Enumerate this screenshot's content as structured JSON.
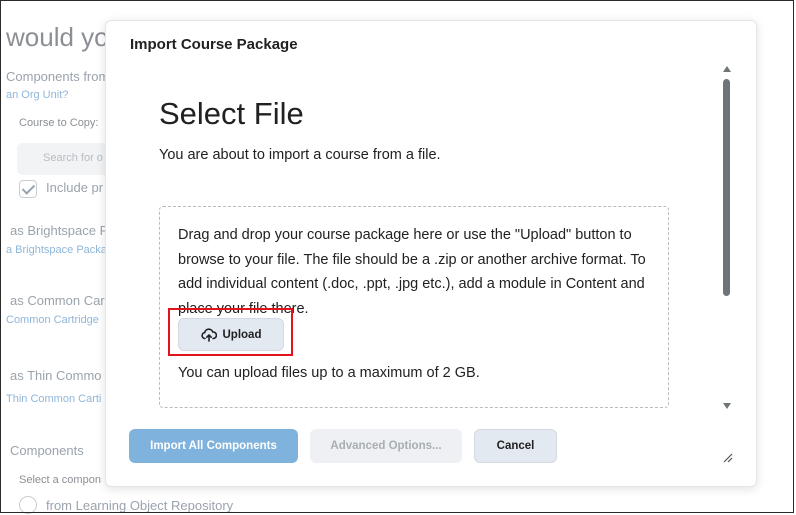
{
  "background": {
    "heading": "would yo",
    "sections": [
      {
        "title": "Components from",
        "link": "an Org Unit?"
      },
      {
        "title": "as Brightspace P",
        "link": "a Brightspace Packa"
      },
      {
        "title": "as Common Car",
        "link": "Common Cartridge"
      },
      {
        "title": "as Thin Commo",
        "link": "Thin Common Carti"
      },
      {
        "title": "Components",
        "link": ""
      }
    ],
    "course_to_copy_label": "Course to Copy:",
    "search_placeholder": "Search for o",
    "include_label": "Include pr",
    "select_component_label": "Select a compon",
    "repository_option": "from Learning Object Repository"
  },
  "dialog": {
    "title": "Import Course Package",
    "heading": "Select File",
    "intro": "You are about to import a course from a file.",
    "dropzone_text": "Drag and drop your course package here or use the \"Upload\" button to browse to your file. The file should be a .zip or another archive format. To add individual content (.doc, .ppt, .jpg etc.), add a module in Content and place your file there.",
    "upload_label": "Upload",
    "upload_icon": "cloud-upload-icon",
    "limit_text": "You can upload files up to a maximum of 2 GB."
  },
  "footer": {
    "import_all_label": "Import All Components",
    "advanced_label": "Advanced Options...",
    "cancel_label": "Cancel"
  },
  "colors": {
    "highlight": "#e2111b",
    "primary_disabled": "#7fb2dc",
    "link": "#8fb6d9"
  }
}
